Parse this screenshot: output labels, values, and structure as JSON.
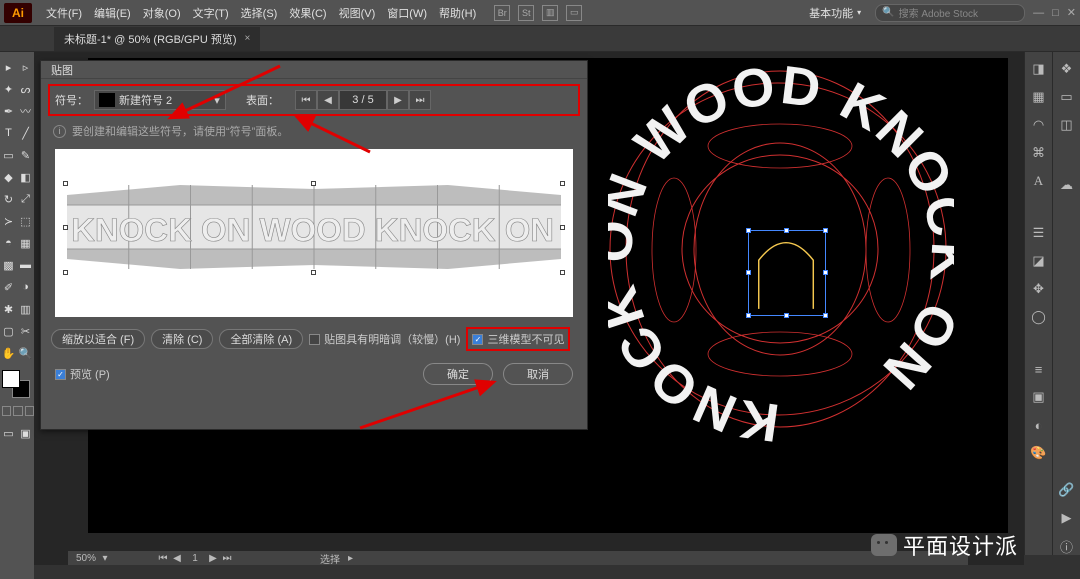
{
  "menubar": {
    "items": [
      "文件(F)",
      "编辑(E)",
      "对象(O)",
      "文字(T)",
      "选择(S)",
      "效果(C)",
      "视图(V)",
      "窗口(W)",
      "帮助(H)"
    ],
    "workspace": "基本功能",
    "search_placeholder": "搜索 Adobe Stock"
  },
  "doc_tab": {
    "title": "未标题-1* @ 50% (RGB/GPU 预览)"
  },
  "dialog": {
    "title": "贴图",
    "symbol_label": "符号：",
    "symbol_name": "新建符号 2",
    "surface_label": "表面：",
    "surface_current": "3",
    "surface_total": "5",
    "info_text": "要创建和编辑这些符号，请使用“符号”面板。",
    "preview_text": "KNOCK ON WOOD  KNOCK ON WOOD",
    "btn_fit": "缩放以适合 (F)",
    "btn_clear": "清除 (C)",
    "btn_clear_all": "全部清除 (A)",
    "chk_shade": "贴图具有明暗调（较慢）(H)",
    "chk_invisible": "三维模型不可见",
    "chk_preview": "预览 (P)",
    "ok": "确定",
    "cancel": "取消"
  },
  "statusbar": {
    "zoom": "50%",
    "tool_label": "选择"
  },
  "artwork": {
    "ring_text": "KNOCK ON WOOD"
  },
  "watermark": "平面设计派"
}
